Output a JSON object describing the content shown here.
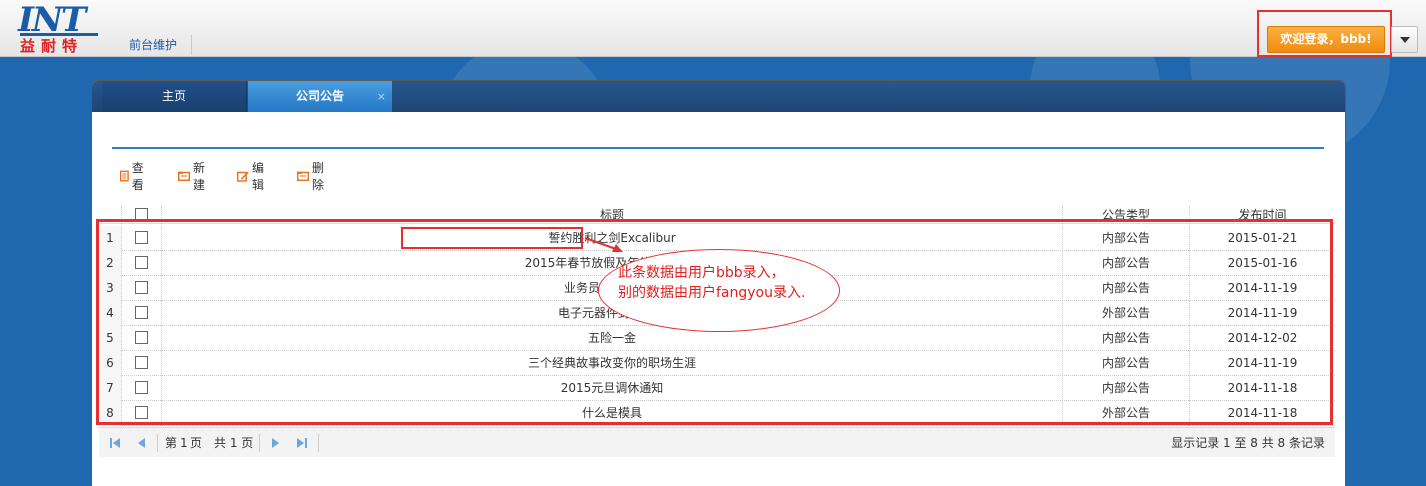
{
  "header": {
    "logo_text": "INT",
    "logo_cn": "益耐特",
    "nav_link": "前台维护",
    "welcome_button": "欢迎登录，bbb!"
  },
  "tabs": [
    {
      "label": "主页"
    },
    {
      "label": "公司公告",
      "close": "×"
    }
  ],
  "toolbar": {
    "view": "查看",
    "create": "新建",
    "edit": "编辑",
    "delete": "删除"
  },
  "grid": {
    "columns": [
      "标题",
      "公告类型",
      "发布时间"
    ],
    "rows": [
      {
        "num": "1",
        "title": "誓约胜利之剑Excalibur",
        "type": "内部公告",
        "date": "2015-01-21"
      },
      {
        "num": "2",
        "title": "2015年春节放假及年终聚餐通知",
        "type": "内部公告",
        "date": "2015-01-16"
      },
      {
        "num": "3",
        "title": "业务员的基础认知",
        "type": "内部公告",
        "date": "2014-11-19"
      },
      {
        "num": "4",
        "title": "电子元器件封装类型",
        "type": "外部公告",
        "date": "2014-11-19"
      },
      {
        "num": "5",
        "title": "五险一金",
        "type": "内部公告",
        "date": "2014-12-02"
      },
      {
        "num": "6",
        "title": "三个经典故事改变你的职场生涯",
        "type": "内部公告",
        "date": "2014-11-19"
      },
      {
        "num": "7",
        "title": "2015元旦调休通知",
        "type": "内部公告",
        "date": "2014-11-18"
      },
      {
        "num": "8",
        "title": "什么是模具",
        "type": "外部公告",
        "date": "2014-11-18"
      }
    ]
  },
  "pager": {
    "page_prefix": "第",
    "page_value": "1",
    "page_suffix": "页",
    "total_text": "共 1 页",
    "record_info": "显示记录 1 至 8 共 8 条记录"
  },
  "annotation": {
    "line1": "此条数据由用户bbb录入，",
    "line2": "别的数据由用户fangyou录入."
  },
  "colors": {
    "accent_red": "#e53030",
    "header_blue": "#1f67ae",
    "button_orange": "#f08b0f"
  }
}
